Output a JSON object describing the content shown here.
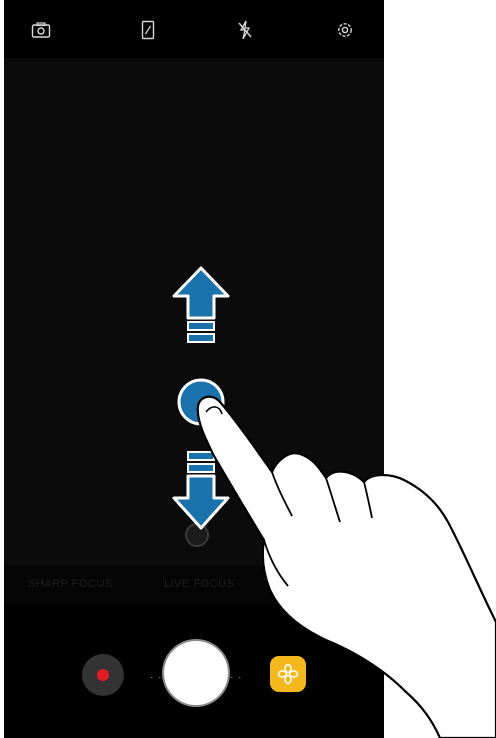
{
  "top_bar": {
    "icons": [
      "switch-camera-icon",
      "aspect-ratio-icon",
      "flash-off-icon",
      "settings-gear-icon"
    ]
  },
  "preview": {
    "focus_gesture": {
      "up_arrow": "arrow-up-icon",
      "down_arrow": "arrow-down-icon",
      "touch_point": "focus-touch-point",
      "hand": "hand-pointer-illustration"
    }
  },
  "modes": {
    "left_label": "SHARP FOCUS",
    "right_label": "LIVE FOCUS"
  },
  "bottom_bar": {
    "record_icon": "record-icon",
    "shutter_icon": "shutter-button",
    "gallery_icon": "gallery-flower-icon",
    "colors": {
      "record": "#e31b23",
      "gallery": "#f5b81a",
      "accent": "#1a72ad"
    }
  }
}
